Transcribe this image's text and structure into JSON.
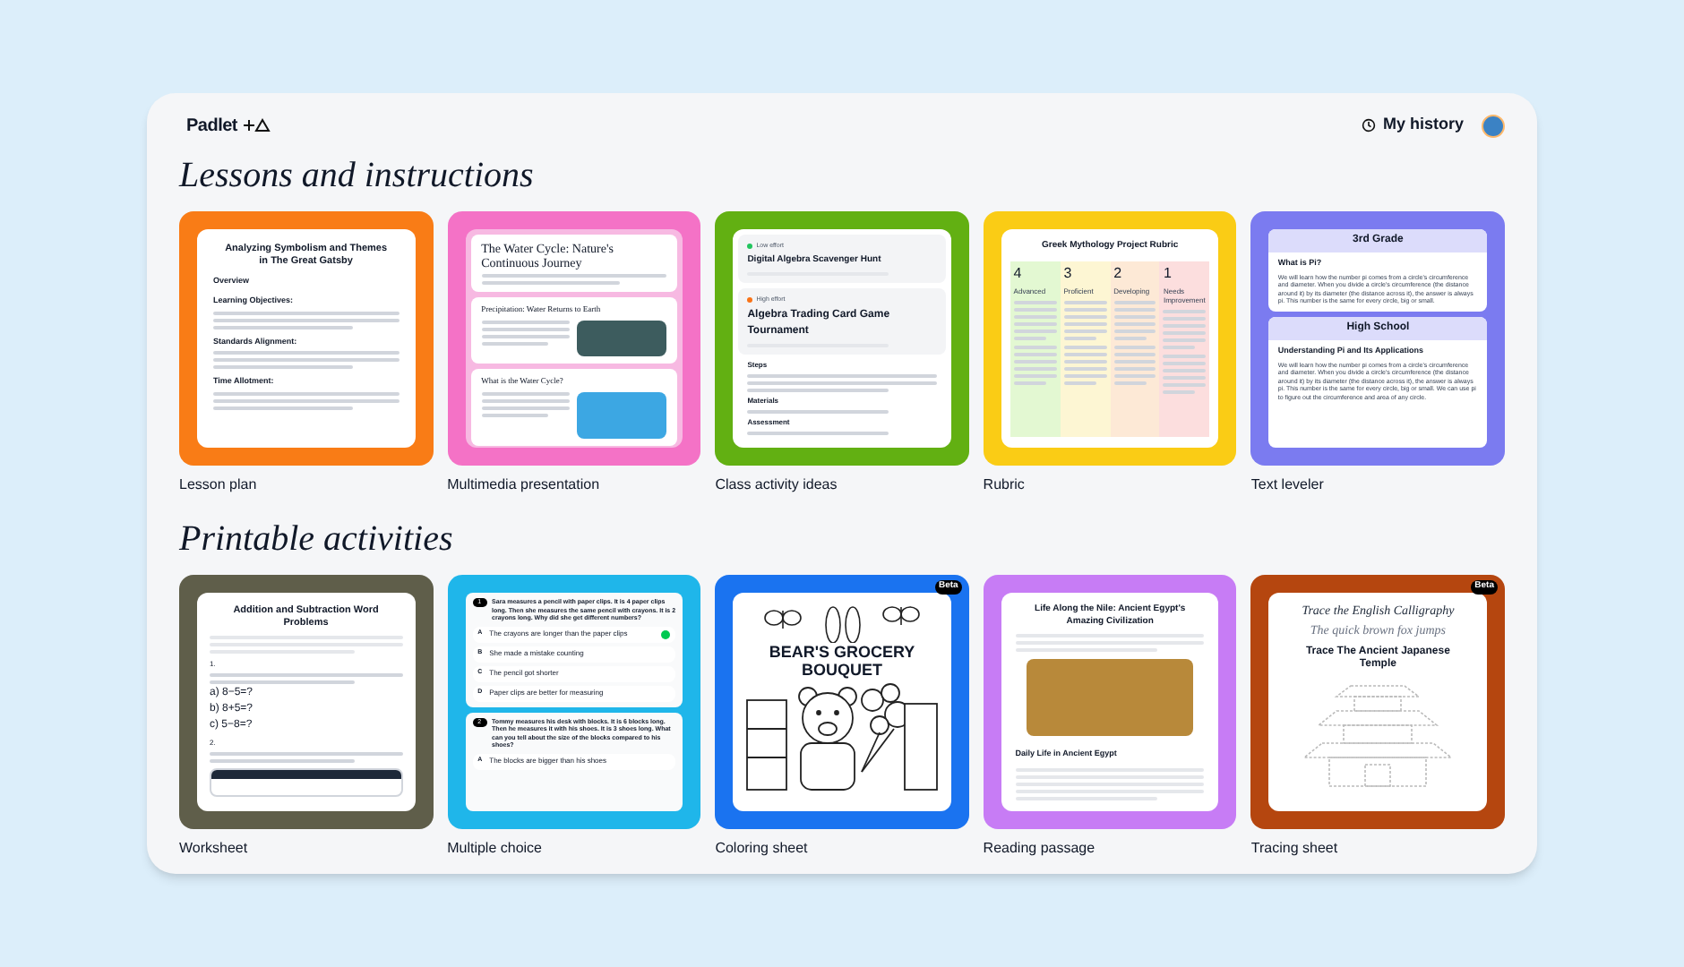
{
  "header": {
    "logo": "Padlet",
    "history_button": "My history"
  },
  "sections": [
    {
      "title": "Lessons and instructions",
      "templates": [
        {
          "kind": "lesson",
          "label": "Lesson plan",
          "color": "#f97c16",
          "preview": {
            "title": "Analyzing Symbolism and Themes in The Great Gatsby",
            "headings": [
              "Overview",
              "Learning Objectives:",
              "Standards Alignment:",
              "Time Allotment:"
            ]
          }
        },
        {
          "kind": "slides",
          "label": "Multimedia presentation",
          "color": "#f472c6",
          "preview": {
            "slides": [
              "The Water Cycle: Nature's Continuous Journey",
              "Precipitation: Water Returns to Earth",
              "What is the Water Cycle?"
            ]
          }
        },
        {
          "kind": "activities",
          "label": "Class activity ideas",
          "color": "#62b012",
          "preview": {
            "activities": [
              {
                "effort": "Low effort",
                "color": "#22c55e",
                "title": "Digital Algebra Scavenger Hunt"
              },
              {
                "effort": "High effort",
                "color": "#f97316",
                "title": "Algebra Trading Card Game Tournament"
              }
            ],
            "headings": [
              "Steps",
              "Materials",
              "Assessment"
            ]
          }
        },
        {
          "kind": "rubric",
          "label": "Rubric",
          "color": "#facc15",
          "preview": {
            "title": "Greek Mythology Project Rubric",
            "levels": [
              {
                "score": "4",
                "name": "Advanced",
                "color": "#e3f8d2"
              },
              {
                "score": "3",
                "name": "Proficient",
                "color": "#fdf6d3"
              },
              {
                "score": "2",
                "name": "Developing",
                "color": "#fde9d6"
              },
              {
                "score": "1",
                "name": "Needs Improvement",
                "color": "#fcdede"
              }
            ]
          }
        },
        {
          "kind": "leveler",
          "label": "Text leveler",
          "color": "#7b7bf0",
          "preview": {
            "levels": [
              {
                "grade": "3rd Grade",
                "heading": "What is Pi?",
                "text": "We will learn how the number pi comes from a circle's circumference and diameter. When you divide a circle's circumference (the distance around it) by its diameter (the distance across it), the answer is always pi. This number is the same for every circle, big or small."
              },
              {
                "grade": "High School",
                "heading": "Understanding Pi and Its Applications",
                "text": "We will learn how the number pi comes from a circle's circumference and diameter. When you divide a circle's circumference (the distance around it) by its diameter (the distance across it), the answer is always pi. This number is the same for every circle, big or small. We can use pi to figure out the circumference and area of any circle."
              }
            ]
          }
        }
      ]
    },
    {
      "title": "Printable activities",
      "templates": [
        {
          "kind": "worksheet",
          "label": "Worksheet",
          "color": "#5f5e4a",
          "preview": {
            "title": "Addition and Subtraction Word Problems",
            "problems": [
              {
                "number": "1.",
                "options": [
                  "a) 8−5=?",
                  "b) 8+5=?",
                  "c) 5−8=?"
                ]
              },
              {
                "number": "2."
              }
            ]
          }
        },
        {
          "kind": "quiz",
          "label": "Multiple choice",
          "color": "#1fb6ea",
          "preview": {
            "questions": [
              {
                "number": "1",
                "text": "Sara measures a pencil with paper clips. It is 4 paper clips long. Then she measures the same pencil with crayons. It is 2 crayons long. Why did she get different numbers?",
                "options": [
                  {
                    "letter": "A",
                    "text": "The crayons are longer than the paper clips",
                    "correct": true
                  },
                  {
                    "letter": "B",
                    "text": "She made a mistake counting",
                    "correct": false
                  },
                  {
                    "letter": "C",
                    "text": "The pencil got shorter",
                    "correct": false
                  },
                  {
                    "letter": "D",
                    "text": "Paper clips are better for measuring",
                    "correct": false
                  }
                ]
              },
              {
                "number": "2",
                "text": "Tommy measures his desk with blocks. It is 6 blocks long. Then he measures it with his shoes. It is 3 shoes long. What can you tell about the size of the blocks compared to his shoes?",
                "options": [
                  {
                    "letter": "A",
                    "text": "The blocks are bigger than his shoes",
                    "correct": false
                  }
                ]
              }
            ]
          }
        },
        {
          "kind": "coloring",
          "label": "Coloring sheet",
          "color": "#1a73f0",
          "badge": "Beta",
          "preview": {
            "title": "BEAR'S GROCERY BOUQUET"
          }
        },
        {
          "kind": "reading",
          "label": "Reading passage",
          "color": "#c77cf5",
          "preview": {
            "title": "Life Along the Nile: Ancient Egypt's Amazing Civilization",
            "heading": "Daily Life in Ancient Egypt"
          }
        },
        {
          "kind": "tracing",
          "label": "Tracing sheet",
          "color": "#b5460f",
          "badge": "Beta",
          "preview": {
            "calligraphy": "Trace the English Calligraphy",
            "sample": "The quick brown fox jumps",
            "title": "Trace The Ancient Japanese Temple"
          }
        }
      ]
    }
  ]
}
